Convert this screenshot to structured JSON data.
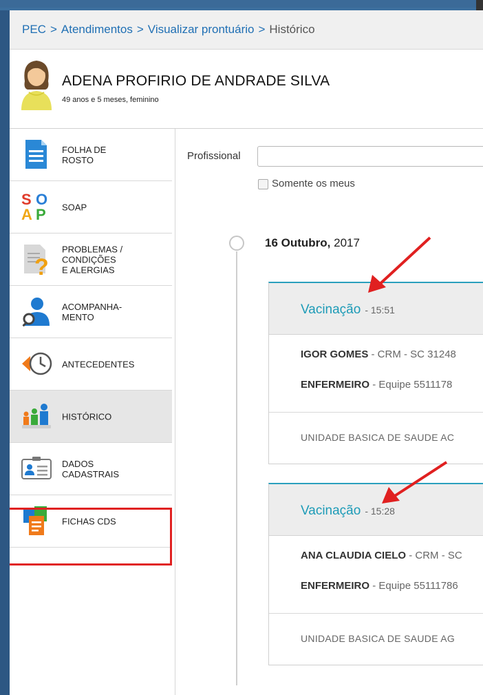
{
  "breadcrumb": {
    "items": [
      "PEC",
      "Atendimentos",
      "Visualizar prontuário"
    ],
    "current": "Histórico",
    "separator": ">"
  },
  "patient": {
    "name": "ADENA PROFIRIO DE ANDRADE SILVA",
    "info": "49 anos e 5 meses, feminino"
  },
  "sidebar": {
    "items": [
      {
        "label": "FOLHA DE\nROSTO",
        "icon": "document-icon"
      },
      {
        "label": "SOAP",
        "icon": "soap-icon"
      },
      {
        "label": "PROBLEMAS /\nCONDIÇÕES\nE ALERGIAS",
        "icon": "question-document-icon"
      },
      {
        "label": "ACOMPANHA-\nMENTO",
        "icon": "person-search-icon"
      },
      {
        "label": "ANTECEDENTES",
        "icon": "clock-back-icon"
      },
      {
        "label": "HISTÓRICO",
        "icon": "family-icon"
      },
      {
        "label": "DADOS\nCADASTRAIS",
        "icon": "id-card-icon"
      },
      {
        "label": "FICHAS CDS",
        "icon": "forms-icon"
      }
    ],
    "active_index": 5
  },
  "filter": {
    "profissional_label": "Profissional",
    "profissional_value": "",
    "only_mine_label": "Somente os meus"
  },
  "timeline": {
    "date_day": "16 Outubro,",
    "date_year": "2017",
    "cards": [
      {
        "title": "Vacinação",
        "time": "- 15:51",
        "prof_name": "IGOR GOMES",
        "prof_reg": "- CRM - SC 31248",
        "role": "ENFERMEIRO",
        "team": "- Equipe 5511178",
        "unit": "UNIDADE BASICA DE SAUDE AC"
      },
      {
        "title": "Vacinação",
        "time": "- 15:28",
        "prof_name": "ANA CLAUDIA CIELO",
        "prof_reg": "- CRM - SC",
        "role": "ENFERMEIRO",
        "team": "- Equipe 55111786",
        "unit": "UNIDADE BASICA DE SAUDE AG"
      }
    ]
  },
  "colors": {
    "link": "#1f6fb4",
    "accent": "#1d9bb7",
    "highlight": "#e02020",
    "frame": "#2d5783"
  }
}
